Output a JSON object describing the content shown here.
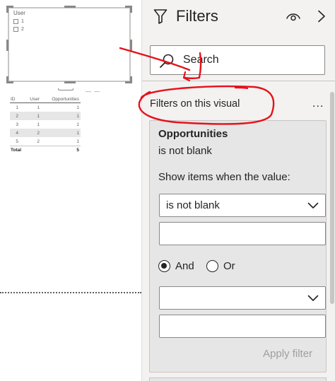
{
  "canvas": {
    "slicer": {
      "title": "User",
      "items": [
        "1",
        "2"
      ]
    },
    "table": {
      "headers": [
        "ID",
        "User",
        "Opportunities"
      ],
      "rows": [
        [
          "1",
          "1",
          "1"
        ],
        [
          "2",
          "1",
          "1"
        ],
        [
          "3",
          "1",
          "1"
        ],
        [
          "4",
          "2",
          "1"
        ],
        [
          "5",
          "2",
          "1"
        ]
      ],
      "total": [
        "Total",
        "",
        "5"
      ]
    },
    "grip_dashes": "— —"
  },
  "filters_pane": {
    "title": "Filters",
    "icons": {
      "header": "funnel-icon",
      "visibility": "eye-icon",
      "collapse": "chevron-right-icon",
      "search": "search-icon",
      "more": "more-options-icon"
    },
    "search": {
      "placeholder": "Search"
    },
    "section_title": "Filters on this visual",
    "more_label": "...",
    "card": {
      "field": "Opportunities",
      "summary": "is not blank",
      "show_items_label": "Show items when the value:",
      "condition1": "is not blank",
      "value1": "",
      "operator_and": "And",
      "operator_or": "Or",
      "selected_operator": "And",
      "condition2": "",
      "value2": "",
      "apply_label": "Apply filter"
    }
  },
  "colors": {
    "pane_bg": "#f3f2f1",
    "card_bg": "#e6e6e6",
    "annotation": "#e8101a",
    "disabled_text": "#a19f9d"
  }
}
